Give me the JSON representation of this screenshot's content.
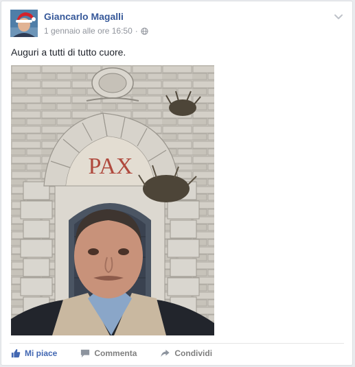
{
  "post": {
    "author": "Giancarlo Magalli",
    "timestamp": "1 gennaio alle ore 16:50",
    "separator": "·",
    "privacy_icon": "globe-icon",
    "menu_icon": "chevron-down-icon",
    "text": "Auguri a tutti di tutto cuore.",
    "photo_sign": "PAX"
  },
  "actions": {
    "like_label": "Mi piace",
    "comment_label": "Commenta",
    "share_label": "Condividi"
  },
  "colors": {
    "link": "#365899",
    "like": "#4267b2",
    "meta": "#90949c",
    "action": "#7f7f7f"
  }
}
